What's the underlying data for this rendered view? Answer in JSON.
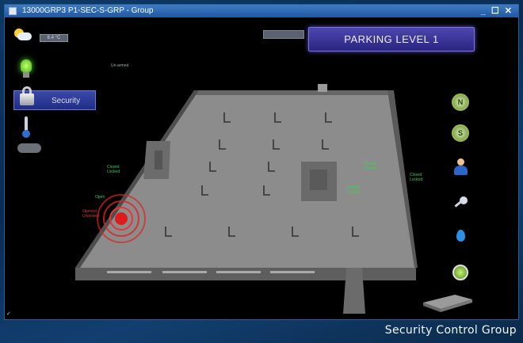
{
  "window": {
    "title": "13000GRP3 P1-SEC-S-GRP - Group",
    "controls": "_ ☐ ✕"
  },
  "header": {
    "weather_icon": "partly-cloudy-icon",
    "temperature": "6.4 °C",
    "small_note": "Un-armed",
    "level_title": "PARKING LEVEL 1"
  },
  "left_nav": {
    "lighting_icon": "lightbulb-icon",
    "security_label": "Security",
    "security_icon": "padlock-icon",
    "climate_icon": "thermometer-icon",
    "weather_icon": "cloud-icon"
  },
  "floor_status": {
    "door_1": {
      "state": "Closed",
      "lock": "Locked"
    },
    "door_2": {
      "state": "Closed",
      "lock": "Locked"
    },
    "door_3": {
      "state": "Closed",
      "lock": "Locked"
    },
    "door_4": {
      "state": "Closed",
      "lock": "Locked"
    },
    "door_5": {
      "state": "Open",
      "lock": ""
    },
    "door_alarm": {
      "state": "Opened",
      "lock": "Unlocked"
    }
  },
  "right_nav": {
    "north": "N",
    "south": "S",
    "user_icon": "person-icon",
    "key_icon": "key-icon",
    "water_icon": "water-drop-icon",
    "clock_icon": "clock-icon",
    "building_icon": "building-icon"
  },
  "footer": {
    "caption": "Security Control Group",
    "corner_mark": "✓"
  },
  "colors": {
    "banner": "#3a34a0",
    "status_ok": "#37d54a",
    "status_alarm": "#e03434"
  }
}
